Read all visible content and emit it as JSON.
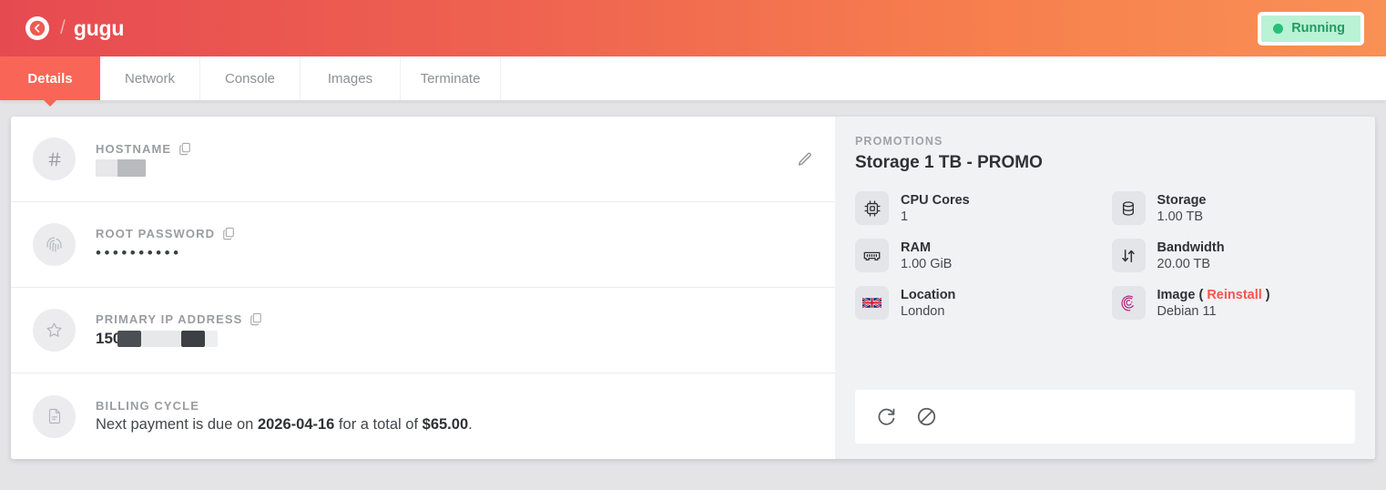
{
  "header": {
    "back_icon": "arrow-left-circle-icon",
    "separator": "/",
    "title": "gugu",
    "status": {
      "label": "Running",
      "dot_color": "#27c07a",
      "bg_color": "#b9f2d5"
    },
    "gradient_from": "#e64a51",
    "gradient_to": "#f99055"
  },
  "tabs": [
    {
      "label": "Details",
      "active": true
    },
    {
      "label": "Network",
      "active": false
    },
    {
      "label": "Console",
      "active": false
    },
    {
      "label": "Images",
      "active": false
    },
    {
      "label": "Terminate",
      "active": false
    }
  ],
  "details": {
    "rows": [
      {
        "icon": "hash-icon",
        "label": "HOSTNAME",
        "copy_icon": "copy-icon",
        "value": "",
        "value_redacted": true,
        "edit_icon": "pencil-icon"
      },
      {
        "icon": "fingerprint-icon",
        "label": "ROOT PASSWORD",
        "copy_icon": "copy-icon",
        "value": "••••••••••",
        "value_redacted": false
      },
      {
        "icon": "star-icon",
        "label": "PRIMARY IP ADDRESS",
        "copy_icon": "copy-icon",
        "value_prefix": "150",
        "value_redacted": true
      },
      {
        "icon": "document-icon",
        "label": "BILLING CYCLE",
        "billing": {
          "prefix": "Next payment is due on ",
          "date": "2026-04-16",
          "middle": " for a total of ",
          "amount": "$65.00",
          "suffix": "."
        }
      }
    ]
  },
  "promotions": {
    "label": "PROMOTIONS",
    "title": "Storage 1 TB - PROMO",
    "specs": [
      {
        "icon": "cpu-icon",
        "name": "CPU Cores",
        "value": "1"
      },
      {
        "icon": "database-icon",
        "name": "Storage",
        "value": "1.00 TB"
      },
      {
        "icon": "ram-icon",
        "name": "RAM",
        "value": "1.00 GiB"
      },
      {
        "icon": "transfer-icon",
        "name": "Bandwidth",
        "value": "20.00 TB"
      },
      {
        "icon": "uk-flag-icon",
        "name": "Location",
        "value": "London"
      },
      {
        "icon": "debian-icon",
        "name": "Image",
        "value": "Debian 11",
        "link": "Reinstall",
        "link_color": "#f9544d",
        "paren_open": "(",
        "paren_close": ")"
      }
    ],
    "actions": [
      {
        "icon": "restart-icon",
        "name": "restart"
      },
      {
        "icon": "power-off-icon",
        "name": "power-off"
      }
    ]
  }
}
